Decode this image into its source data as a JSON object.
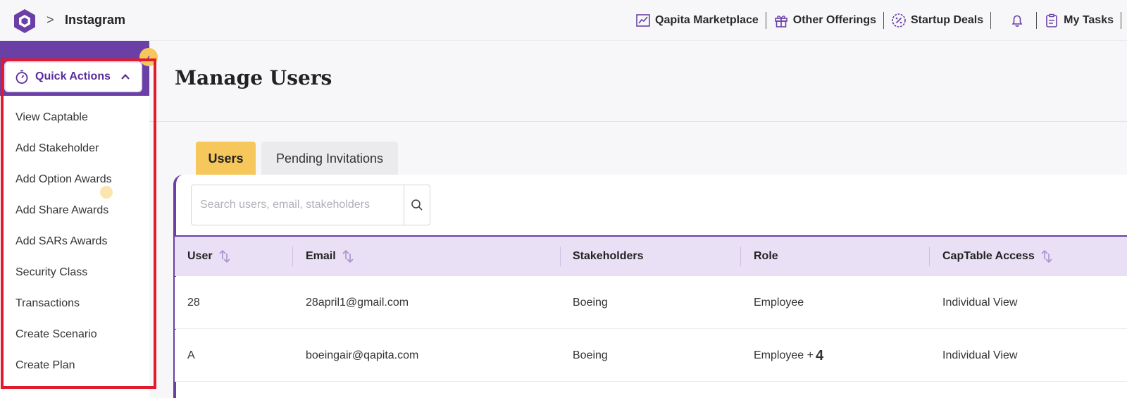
{
  "breadcrumb": {
    "separator": ">",
    "current": "Instagram"
  },
  "topnav": {
    "marketplace": "Qapita Marketplace",
    "offerings": "Other Offerings",
    "deals": "Startup Deals",
    "tasks": "My Tasks"
  },
  "sidebar": {
    "quick_actions_label": "Quick Actions",
    "items": [
      "View Captable",
      "Add Stakeholder",
      "Add Option Awards",
      "Add Share Awards",
      "Add SARs Awards",
      "Security Class",
      "Transactions",
      "Create Scenario",
      "Create Plan"
    ]
  },
  "page": {
    "title": "Manage Users"
  },
  "tabs": {
    "users": "Users",
    "pending": "Pending Invitations"
  },
  "search": {
    "placeholder": "Search users, email, stakeholders"
  },
  "table": {
    "columns": {
      "user": "User",
      "email": "Email",
      "stakeholders": "Stakeholders",
      "role": "Role",
      "access": "CapTable Access"
    },
    "rows": [
      {
        "user": "28",
        "email": "28april1@gmail.com",
        "stakeholders": "Boeing",
        "role": "Employee",
        "extra": "",
        "access": "Individual View"
      },
      {
        "user": "A",
        "email": "boeingair@qapita.com",
        "stakeholders": "Boeing",
        "role": "Employee +",
        "extra": "4",
        "access": "Individual View"
      }
    ]
  },
  "colors": {
    "brand_purple": "#6a3fa6",
    "accent_yellow": "#f6c85c",
    "header_lavender": "#e9e0f6",
    "highlight_red": "#e01b2d"
  }
}
